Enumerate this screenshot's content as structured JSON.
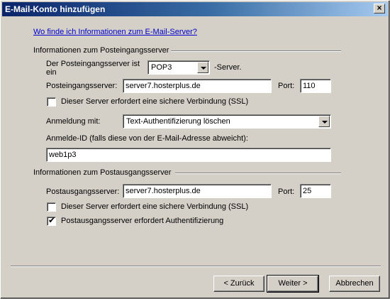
{
  "window": {
    "title": "E-Mail-Konto hinzufügen",
    "close_glyph": "×"
  },
  "help_link": "Wo finde ich Informationen zum E-Mail-Server?",
  "incoming": {
    "group_label": "Informationen zum Posteingangsserver",
    "type_label": "Der Posteingangsserver ist ein",
    "type_value": "POP3",
    "type_suffix": "-Server.",
    "server_label": "Posteingangsserver:",
    "server_value": "server7.hosterplus.de",
    "port_label": "Port:",
    "port_value": "110",
    "ssl_label": "Dieser Server erfordert eine sichere Verbindung (SSL)",
    "ssl_checked": false,
    "login_label": "Anmeldung mit:",
    "login_value": "Text-Authentifizierung löschen",
    "loginid_label": "Anmelde-ID (falls diese von der E-Mail-Adresse abweicht):",
    "loginid_value": "web1p3"
  },
  "outgoing": {
    "group_label": "Informationen zum Postausgangsserver",
    "server_label": "Postausgangsserver:",
    "server_value": "server7.hosterplus.de",
    "port_label": "Port:",
    "port_value": "25",
    "ssl_label": "Dieser Server erfordert eine sichere Verbindung (SSL)",
    "ssl_checked": false,
    "auth_label": "Postausgangsserver erfordert Authentifizierung",
    "auth_checked": true,
    "check_glyph": "✔"
  },
  "buttons": {
    "back": "< Zurück",
    "next": "Weiter >",
    "cancel": "Abbrechen"
  }
}
